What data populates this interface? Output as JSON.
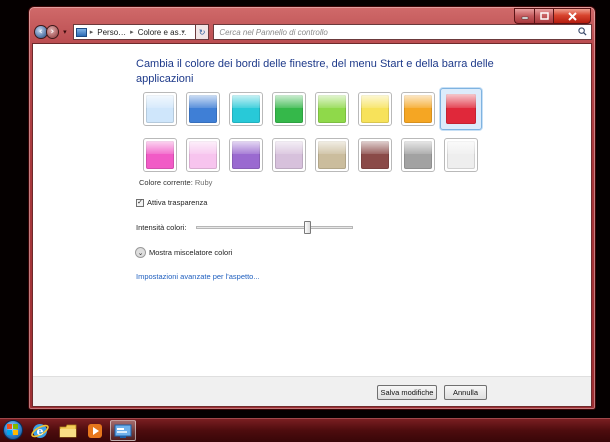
{
  "window": {
    "caption_buttons": {
      "minimize": "minimize-icon",
      "maximize": "maximize-icon",
      "close": "close-icon"
    }
  },
  "navbar": {
    "breadcrumb": [
      "Perso…",
      "Colore e as…"
    ],
    "search_placeholder": "Cerca nel Pannello di controllo"
  },
  "page": {
    "title": "Cambia il colore dei bordi delle finestre, del menu Start e della barra delle applicazioni",
    "current_color_label": "Colore corrente:",
    "current_color_value": "Ruby",
    "transparency_label": "Attiva trasparenza",
    "transparency_checked": true,
    "intensity_label": "Intensità colori:",
    "intensity_value": 0.72,
    "mixer_label": "Mostra miscelatore colori",
    "advanced_link": "Impostazioni avanzate per l'aspetto..."
  },
  "swatches": [
    {
      "name": "sky",
      "color": "#cfe6fb"
    },
    {
      "name": "twilight",
      "color": "#3f7fd6"
    },
    {
      "name": "sea",
      "color": "#28c9d8"
    },
    {
      "name": "leaf",
      "color": "#35b84a"
    },
    {
      "name": "lime",
      "color": "#8fd94a"
    },
    {
      "name": "sun",
      "color": "#f7e25a"
    },
    {
      "name": "pumpkin",
      "color": "#f5a623"
    },
    {
      "name": "ruby",
      "color": "#e0283a",
      "selected": true
    },
    {
      "name": "fuchsia",
      "color": "#f15bc6"
    },
    {
      "name": "blush",
      "color": "#f7c4ee"
    },
    {
      "name": "violet",
      "color": "#9a6ad0"
    },
    {
      "name": "lavender",
      "color": "#d7c1dc"
    },
    {
      "name": "taupe",
      "color": "#cbbd9d"
    },
    {
      "name": "chocolate",
      "color": "#8a4a48"
    },
    {
      "name": "slate",
      "color": "#a2a2a2"
    },
    {
      "name": "frost",
      "color": "#eeeeee"
    }
  ],
  "footer": {
    "save_label": "Salva modifiche",
    "cancel_label": "Annulla"
  },
  "taskbar": {
    "items": [
      "internet-explorer-icon",
      "folder-icon",
      "media-player-icon",
      "control-panel-icon"
    ],
    "active_item": "control-panel-icon"
  },
  "colors": {
    "accent": "#b0393d",
    "title_text": "#1e3a8a",
    "link": "#1f5fbf"
  }
}
